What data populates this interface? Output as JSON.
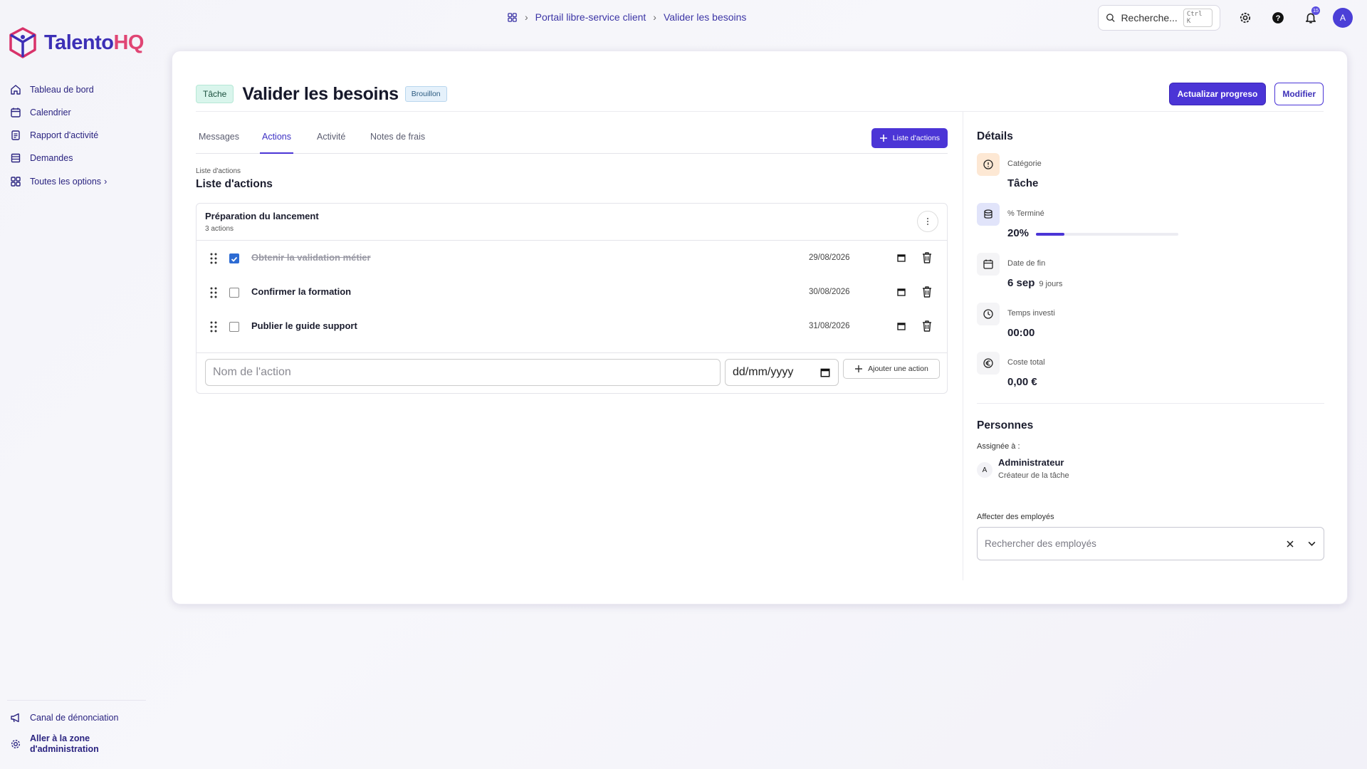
{
  "app": {
    "logo_main": "Talento",
    "logo_accent": "HQ"
  },
  "sidebar": {
    "items": [
      {
        "label": "Tableau de bord",
        "icon": "home-icon"
      },
      {
        "label": "Calendrier",
        "icon": "calendar-icon"
      },
      {
        "label": "Rapport d'activité",
        "icon": "report-icon"
      },
      {
        "label": "Demandes",
        "icon": "list-icon"
      }
    ],
    "all_options": "Toutes les options",
    "bottom": [
      {
        "label": "Canal de dénonciation",
        "icon": "megaphone-icon"
      },
      {
        "label": "Aller à la zone d'administration",
        "icon": "gear-icon"
      }
    ]
  },
  "breadcrumb": {
    "items": [
      "Portail libre-service client",
      "Valider les besoins"
    ]
  },
  "topbar": {
    "search_placeholder": "Recherche...",
    "shortcut": "Ctrl K",
    "notification_count": "15",
    "avatar_initial": "A"
  },
  "task": {
    "type_tag": "Tâche",
    "title": "Valider les besoins",
    "status_tag": "Brouillon",
    "btn_progress": "Actualizar progreso",
    "btn_edit": "Modifier"
  },
  "tabs": [
    {
      "label": "Messages",
      "active": false
    },
    {
      "label": "Actions",
      "active": true
    },
    {
      "label": "Activité",
      "active": false
    },
    {
      "label": "Notes de frais",
      "active": false
    }
  ],
  "add_list_button": "Liste d'actions",
  "section": {
    "small": "Liste d'actions",
    "title": "Liste d'actions"
  },
  "checklist": {
    "title": "Préparation du lancement",
    "count": "3 actions",
    "items": [
      {
        "label": "Obtenir la validation métier",
        "date": "29/08/2026",
        "done": true
      },
      {
        "label": "Confirmer la formation",
        "date": "30/08/2026",
        "done": false
      },
      {
        "label": "Publier le guide support",
        "date": "31/08/2026",
        "done": false
      }
    ],
    "input_placeholder": "Nom de l'action",
    "date_placeholder": "dd/mm/yyyy",
    "add_button": "Ajouter une action"
  },
  "details": {
    "title": "Détails",
    "category_label": "Catégorie",
    "category_value": "Tâche",
    "percent_label": "% Terminé",
    "percent_value": "20%",
    "percent_progress": 0.2,
    "end_label": "Date de fin",
    "end_value": "6 sep",
    "end_sub": "9 jours",
    "time_label": "Temps investi",
    "time_value": "00:00",
    "cost_label": "Coste total",
    "cost_value": "0,00 €"
  },
  "people": {
    "title": "Personnes",
    "assigned_label": "Assignée à :",
    "person_initial": "A",
    "person_name": "Administrateur",
    "person_role": "Créateur de la tâche",
    "assign_label": "Affecter des employés",
    "assign_placeholder": "Rechercher des employés"
  },
  "colors": {
    "accent": "#4b35d6",
    "brand": "#3c2fb6",
    "brand_accent": "#e04574"
  }
}
